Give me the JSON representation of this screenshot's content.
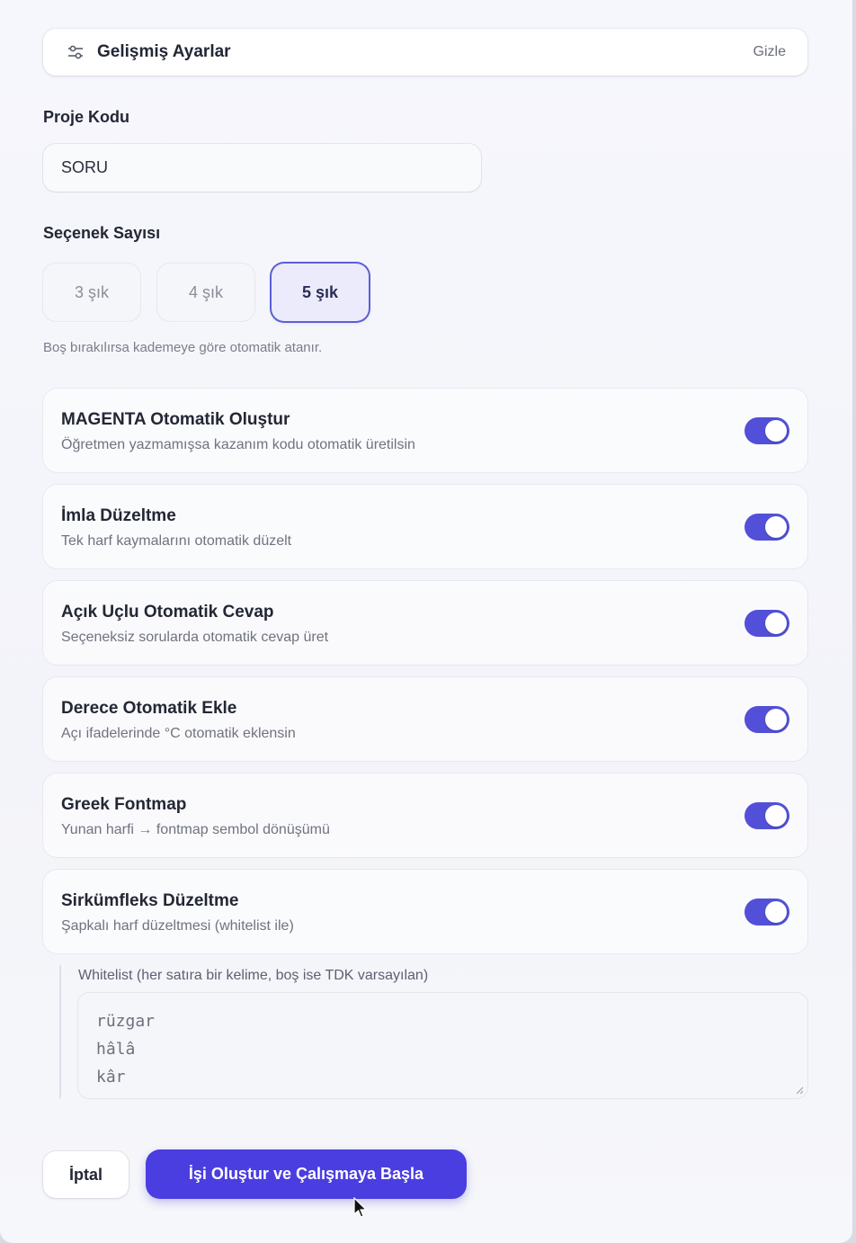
{
  "advanced": {
    "title": "Gelişmiş Ayarlar",
    "hide_label": "Gizle",
    "icon": "sliders-icon"
  },
  "project": {
    "label": "Proje Kodu",
    "value": "SORU"
  },
  "options": {
    "label": "Seçenek Sayısı",
    "choices": [
      "3 şık",
      "4 şık",
      "5 şık"
    ],
    "selected": "5 şık",
    "hint": "Boş bırakılırsa kademeye göre otomatik atanır."
  },
  "settings": [
    {
      "title": "MAGENTA Otomatik Oluştur",
      "desc": "Öğretmen yazmamışsa kazanım kodu otomatik üretilsin",
      "enabled": true
    },
    {
      "title": "İmla Düzeltme",
      "desc": "Tek harf kaymalarını otomatik düzelt",
      "enabled": true
    },
    {
      "title": "Açık Uçlu Otomatik Cevap",
      "desc": "Seçeneksiz sorularda otomatik cevap üret",
      "enabled": true
    },
    {
      "title": "Derece Otomatik Ekle",
      "desc": "Açı ifadelerinde °C otomatik eklensin",
      "enabled": true
    },
    {
      "title": "Greek Fontmap",
      "desc": "Yunan harfi → fontmap sembol dönüşümü",
      "enabled": true
    },
    {
      "title": "Sirkümfleks Düzeltme",
      "desc": "Şapkalı harf düzeltmesi (whitelist ile)",
      "enabled": true
    }
  ],
  "whitelist": {
    "label": "Whitelist (her satıra bir kelime, boş ise TDK varsayılan)",
    "lines": [
      "rüzgar",
      "hâlâ",
      "kâr"
    ]
  },
  "actions": {
    "cancel": "İptal",
    "submit": "İşi Oluştur ve Çalışmaya Başla"
  },
  "colors": {
    "accent": "#4a3ee0",
    "toggle_on": "#5250d8",
    "selected_border": "#5c5ed6"
  }
}
